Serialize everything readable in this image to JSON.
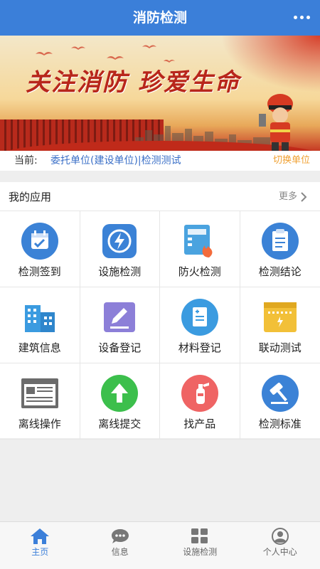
{
  "header": {
    "title": "消防检测",
    "more_icon": "more-dots-icon"
  },
  "banner": {
    "slogan": "关注消防 珍爱生命"
  },
  "current": {
    "label": "当前:",
    "unit": "委托单位(建设单位)|检测测试",
    "switch_label": "切换单位"
  },
  "apps": {
    "title": "我的应用",
    "more": "更多",
    "items": [
      {
        "label": "检测签到",
        "icon": "calendar-check-icon",
        "color": "#3b82d6"
      },
      {
        "label": "设施检测",
        "icon": "lightning-icon",
        "color": "#3b82d6"
      },
      {
        "label": "防火检测",
        "icon": "fire-panel-icon",
        "color": "#4aa3df"
      },
      {
        "label": "检测结论",
        "icon": "clipboard-icon",
        "color": "#3b82d6"
      },
      {
        "label": "建筑信息",
        "icon": "building-icon",
        "color": "#3b9be0"
      },
      {
        "label": "设备登记",
        "icon": "pencil-edit-icon",
        "color": "#8c7fd8"
      },
      {
        "label": "材料登记",
        "icon": "document-add-icon",
        "color": "#3b9be0"
      },
      {
        "label": "联动测试",
        "icon": "control-panel-icon",
        "color": "#f2c038"
      },
      {
        "label": "离线操作",
        "icon": "browser-window-icon",
        "color": "#6b6b6b"
      },
      {
        "label": "离线提交",
        "icon": "upload-arrow-icon",
        "color": "#3cbf4c"
      },
      {
        "label": "找产品",
        "icon": "fire-extinguisher-icon",
        "color": "#ef6464"
      },
      {
        "label": "检测标准",
        "icon": "gavel-icon",
        "color": "#3b82d6"
      }
    ]
  },
  "tabbar": {
    "items": [
      {
        "label": "主页",
        "icon": "home-icon",
        "active": true
      },
      {
        "label": "信息",
        "icon": "chat-bubble-icon",
        "active": false
      },
      {
        "label": "设施检测",
        "icon": "grid-icon",
        "active": false
      },
      {
        "label": "个人中心",
        "icon": "user-icon",
        "active": false
      }
    ],
    "active_color": "#3b7fd9",
    "inactive_color": "#777777"
  }
}
